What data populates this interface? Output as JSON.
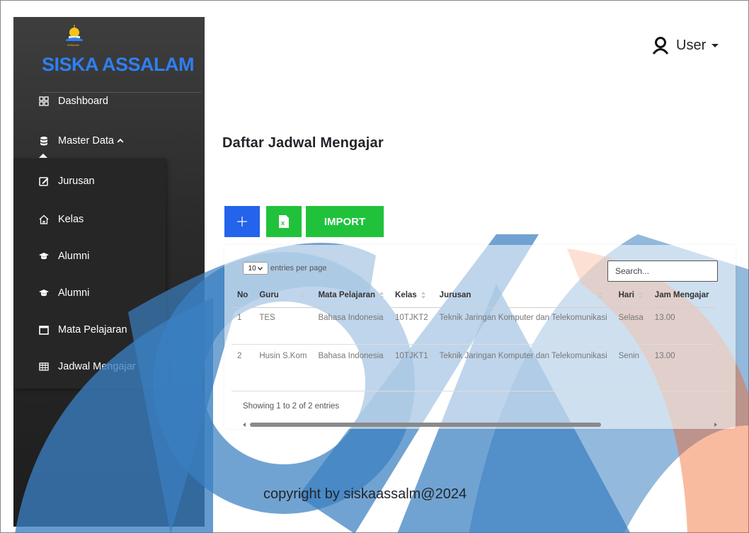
{
  "app": {
    "title": "SISKA ASSALAM"
  },
  "sidebar": {
    "items": [
      {
        "label": "Dashboard",
        "icon": "dashboard-icon"
      },
      {
        "label": "Master Data",
        "icon": "database-icon"
      }
    ],
    "submenu": [
      {
        "label": "Jurusan",
        "icon": "edit-icon"
      },
      {
        "label": "Kelas",
        "icon": "home-icon"
      },
      {
        "label": "Alumni",
        "icon": "graduation-cap-icon"
      },
      {
        "label": "Alumni",
        "icon": "graduation-cap-icon"
      },
      {
        "label": "Mata Pelajaran",
        "icon": "calendar-icon"
      },
      {
        "label": "Jadwal Mengajar",
        "icon": "table-icon"
      }
    ]
  },
  "header": {
    "user_label": "User"
  },
  "main": {
    "title": "Daftar Jadwal Mengajar",
    "import_label": "IMPORT",
    "entries_value": "10",
    "entries_label": "entries per page",
    "search_placeholder": "Search...",
    "columns": [
      "No",
      "Guru",
      "Mata Pelajaran",
      "Kelas",
      "Jurusan",
      "Hari",
      "Jam Mengajar"
    ],
    "rows": [
      [
        "1",
        "TES",
        "Bahasa Indonesia",
        "10TJKT2",
        "Teknik Jaringan Komputer dan Telekomunikasi",
        "Selasa",
        "13.00"
      ],
      [
        "2",
        "Husin S.Kom",
        "Bahasa Indonesia",
        "10TJKT1",
        "Teknik Jaringan Komputer dan Telekomunikasi",
        "Senin",
        "13.00"
      ]
    ],
    "info": "Showing 1 to 2 of 2 entries"
  },
  "footer": {
    "text": "copyright by siskaassalm@2024"
  },
  "colors": {
    "primary": "#2463eb",
    "success": "#20c23b",
    "brand": "#2f7ff0",
    "watermark_blue": "#3a7fc1",
    "watermark_orange": "#f2692a"
  }
}
